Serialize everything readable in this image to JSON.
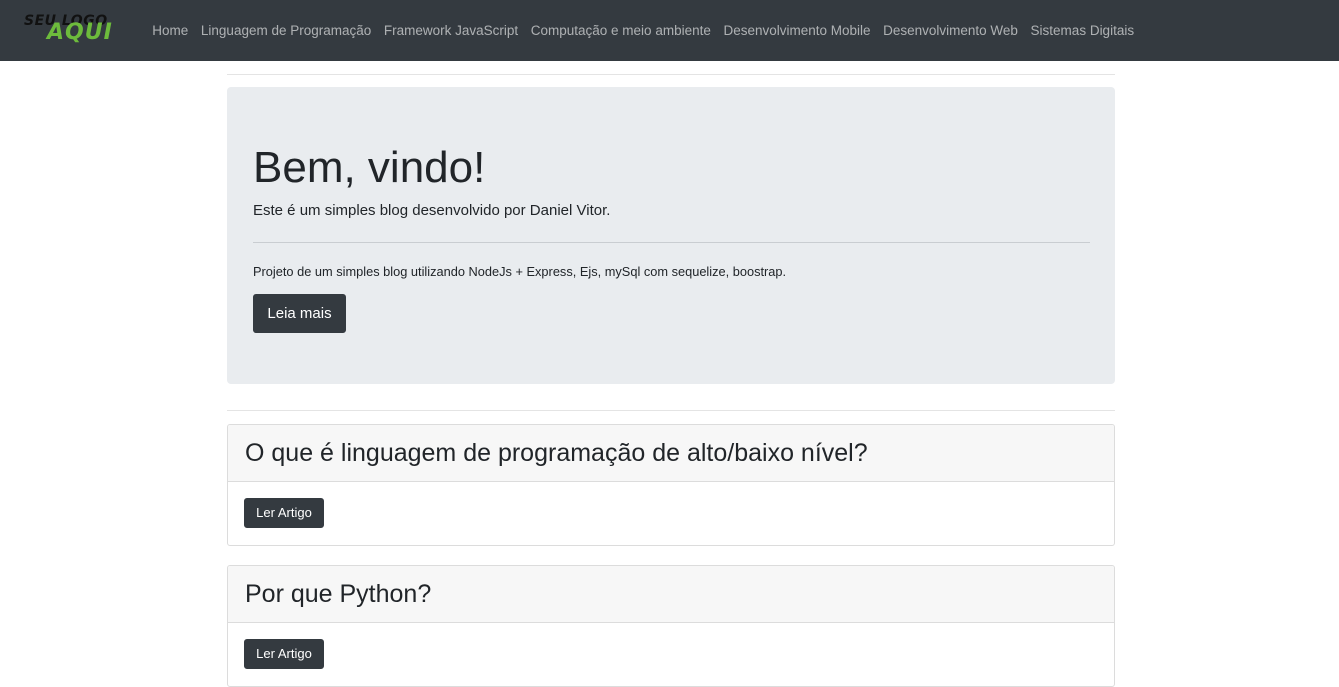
{
  "logo": {
    "line1": "SEU LOGO",
    "line2": "AQUI"
  },
  "nav": {
    "links": [
      "Home",
      "Linguagem de Programação",
      "Framework JavaScript",
      "Computação e meio ambiente",
      "Desenvolvimento Mobile",
      "Desenvolvimento Web",
      "Sistemas Digitais"
    ]
  },
  "jumbotron": {
    "title": "Bem, vindo!",
    "lead": "Este é um simples blog desenvolvido por Daniel Vitor.",
    "text": "Projeto de um simples blog utilizando NodeJs + Express, Ejs, mySql com sequelize, boostrap.",
    "button": "Leia mais"
  },
  "articles": [
    {
      "title": "O que é linguagem de programação de alto/baixo nível?",
      "button": "Ler Artigo"
    },
    {
      "title": "Por que Python?",
      "button": "Ler Artigo"
    }
  ],
  "colors": {
    "navbar": "#343a40",
    "logo_accent": "#6dbb3c",
    "jumbotron": "#e9ecef",
    "button": "#343a40"
  }
}
